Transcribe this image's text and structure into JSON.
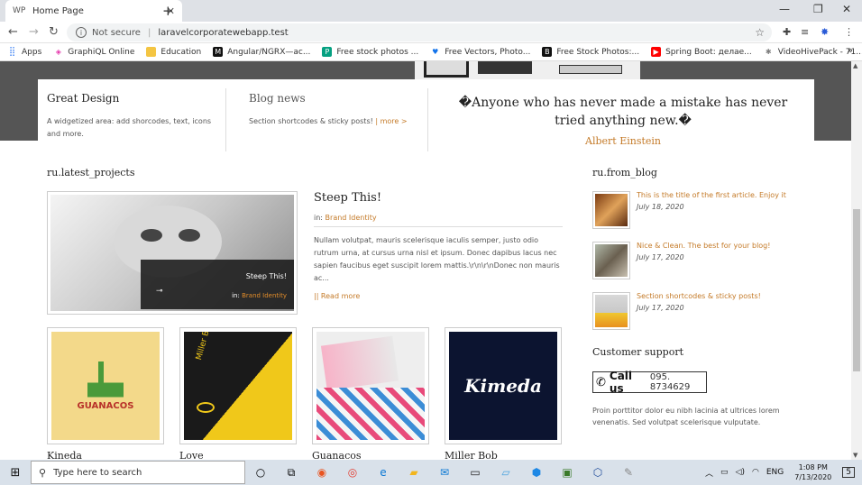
{
  "browser": {
    "tab_title": "Home Page",
    "tab_favicon": "WP",
    "url_security": "Not secure",
    "url": "laravelcorporatewebapp.test",
    "bookmarks": [
      {
        "label": "Apps",
        "icon": "apps-grid-icon",
        "color": "#4285f4",
        "glyph": "⋮"
      },
      {
        "label": "GraphiQL Online",
        "icon": "graphql-icon",
        "color": "#e535ab",
        "glyph": "◈"
      },
      {
        "label": "Education",
        "icon": "folder-icon",
        "color": "#f4c542",
        "glyph": "▬"
      },
      {
        "label": "Angular/NGRX—ac...",
        "icon": "medium-icon",
        "color": "#111111",
        "glyph": "M"
      },
      {
        "label": "Free stock photos ...",
        "icon": "pexels-icon",
        "color": "#05a081",
        "glyph": "P"
      },
      {
        "label": "Free Vectors, Photo...",
        "icon": "freepik-icon",
        "color": "#1273eb",
        "glyph": "♥"
      },
      {
        "label": "Free Stock Photos:...",
        "icon": "burst-icon",
        "color": "#111111",
        "glyph": "B"
      },
      {
        "label": "Spring Boot: делае...",
        "icon": "youtube-icon",
        "color": "#ff0000",
        "glyph": "▶"
      },
      {
        "label": "VideoHivePack - 71...",
        "icon": "videohive-icon",
        "color": "#7a7a7a",
        "glyph": "✱"
      }
    ]
  },
  "features": [
    {
      "title": "Great Design",
      "text": "A widgetized area: add shorcodes, text, icons and more.",
      "more": ""
    },
    {
      "title": "Blog news",
      "text": "Section shortcodes & sticky posts!",
      "more": "| more >"
    }
  ],
  "quote": {
    "text": "�Anyone who has never made a mistake has never tried anything new.�",
    "author": "Albert Einstein"
  },
  "projects": {
    "section_title": "ru.latest_projects",
    "featured": {
      "title": "Steep This!",
      "category_prefix": "in:",
      "category": "Brand Identity",
      "excerpt": "Nullam volutpat, mauris scelerisque iaculis semper, justo odio rutrum urna, at cursus urna nisl et ipsum. Donec dapibus lacus nec sapien faucibus eget suscipit lorem mattis.\\r\\n\\r\\nDonec non mauris ac...",
      "read_more": "|| Read more",
      "overlay_title": "Steep This!",
      "overlay_cat_prefix": "in:",
      "overlay_cat": "Brand Identity"
    },
    "thumbs": [
      {
        "label": "Kineda",
        "art": "Guanacos logo"
      },
      {
        "label": "Love",
        "art": "Miller Bob cards"
      },
      {
        "label": "Guanacos",
        "art": "Pattern cards"
      },
      {
        "label": "Miller Bob",
        "art": "Kimeda logo"
      }
    ]
  },
  "blog": {
    "section_title": "ru.from_blog",
    "items": [
      {
        "title": "This is the title of the first article. Enjoy it",
        "date": "July 18, 2020"
      },
      {
        "title": "Nice & Clean. The best for your blog!",
        "date": "July 17, 2020"
      },
      {
        "title": "Section shortcodes & sticky posts!",
        "date": "July 17, 2020"
      }
    ]
  },
  "support": {
    "title": "Customer support",
    "call_label": "Call us",
    "phone": "095. 8734629",
    "text": "Proin porttitor dolor eu nibh lacinia at ultrices lorem venenatis. Sed volutpat scelerisque vulputate."
  },
  "taskbar": {
    "search_placeholder": "Type here to search",
    "lang": "ENG",
    "time": "1:08 PM",
    "date": "7/13/2020",
    "notifications": "5"
  },
  "colors": {
    "accent": "#c47a28",
    "hero_bg": "#555555"
  }
}
